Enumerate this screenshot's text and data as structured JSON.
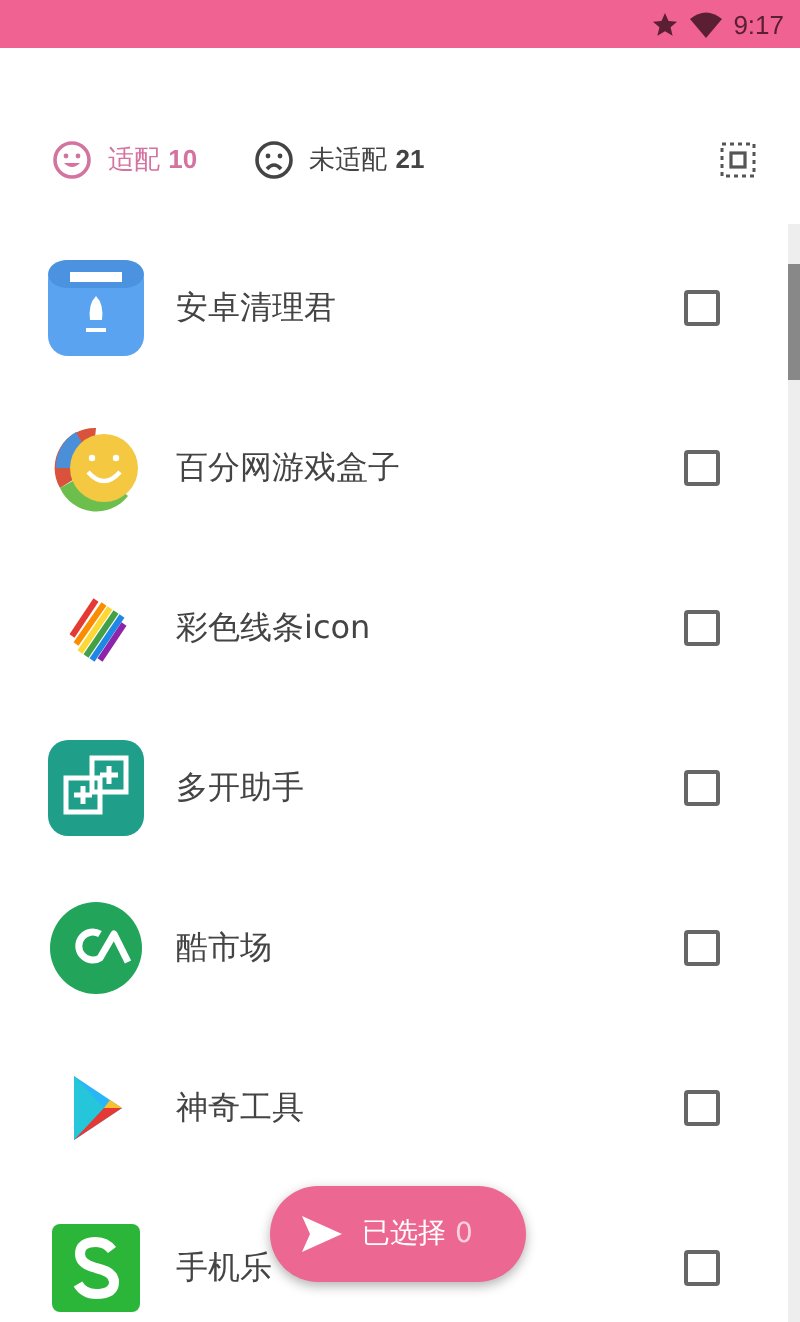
{
  "status_bar": {
    "time": "9:17"
  },
  "tabs": [
    {
      "label": "适配",
      "count": "10",
      "selected": true
    },
    {
      "label": "未适配",
      "count": "21",
      "selected": false
    }
  ],
  "apps": [
    {
      "name": "安卓清理君",
      "checked": false
    },
    {
      "name": "百分网游戏盒子",
      "checked": false
    },
    {
      "name": "彩色线条icon",
      "checked": false
    },
    {
      "name": "多开助手",
      "checked": false
    },
    {
      "name": "酷市场",
      "checked": false
    },
    {
      "name": "神奇工具",
      "checked": false
    },
    {
      "name": "手机乐",
      "checked": false
    }
  ],
  "fab": {
    "label": "已选择",
    "count": "0"
  }
}
